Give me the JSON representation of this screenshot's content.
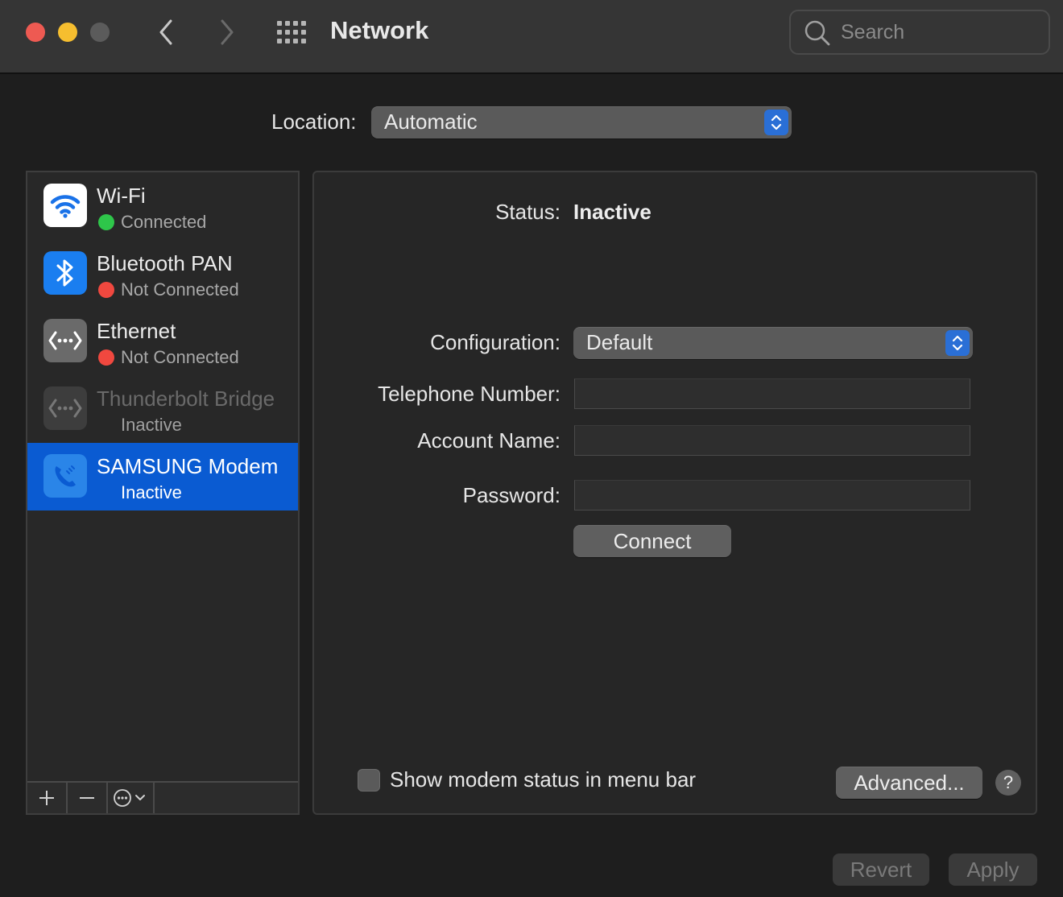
{
  "window": {
    "title": "Network",
    "search_placeholder": "Search"
  },
  "location": {
    "label": "Location:",
    "value": "Automatic"
  },
  "services": [
    {
      "name": "Wi-Fi",
      "status": "Connected",
      "status_color": "#2ec64a"
    },
    {
      "name": "Bluetooth PAN",
      "status": "Not Connected",
      "status_color": "#f0483f"
    },
    {
      "name": "Ethernet",
      "status": "Not Connected",
      "status_color": "#f0483f"
    },
    {
      "name": "Thunderbolt Bridge",
      "status": "Inactive"
    },
    {
      "name": "SAMSUNG Modem",
      "status": "Inactive",
      "selected": true
    }
  ],
  "detail": {
    "status_label": "Status:",
    "status_value": "Inactive",
    "configuration_label": "Configuration:",
    "configuration_value": "Default",
    "telephone_label": "Telephone Number:",
    "telephone_value": "",
    "account_label": "Account Name:",
    "account_value": "",
    "password_label": "Password:",
    "password_value": "",
    "connect_label": "Connect",
    "show_status_label": "Show modem status in menu bar",
    "show_status_checked": false,
    "advanced_label": "Advanced...",
    "help_label": "?"
  },
  "footer": {
    "revert_label": "Revert",
    "apply_label": "Apply"
  },
  "colors": {
    "accent": "#0a5bd2",
    "stepper": "#2a6fd6"
  }
}
